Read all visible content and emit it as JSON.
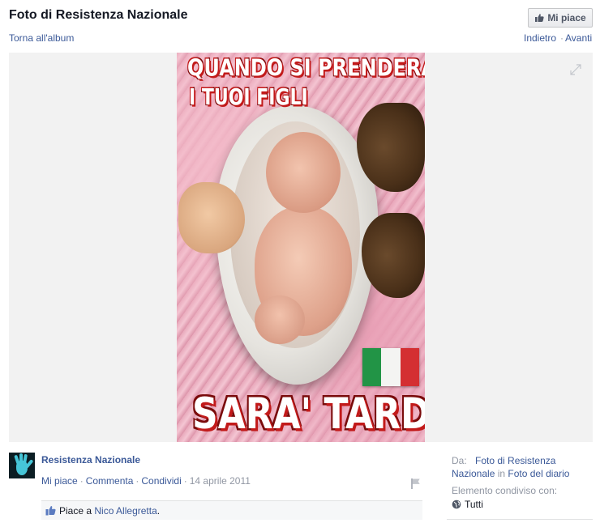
{
  "header": {
    "title": "Foto di Resistenza Nazionale",
    "back_link": "Torna all'album",
    "like_button": "Mi piace",
    "nav_prev": "Indietro",
    "nav_separator": "·",
    "nav_next": "Avanti"
  },
  "photo": {
    "headline_line1": "QUANDO SI PRENDERANNO",
    "headline_line2": "I TUOI FIGLI",
    "headline_bottom": "SARA' TARDI",
    "flag_colors": [
      "#229446",
      "#f4f4f2",
      "#d42f32"
    ]
  },
  "post": {
    "author": "Resistenza Nazionale",
    "actions": [
      "Mi piace",
      "Commenta",
      "Condividi"
    ],
    "date": "14 aprile 2011",
    "likes_prefix": "Piace a",
    "likes_name": "Nico Allegretta",
    "likes_suffix": "."
  },
  "sidebar": {
    "from_label": "Da:",
    "from_link": "Foto di Resistenza Nazionale",
    "from_in": "in",
    "album_link": "Foto del diario",
    "shared_label": "Elemento condiviso con:",
    "audience": "Tutti"
  },
  "colors": {
    "link": "#3b5998",
    "muted": "#9197a3",
    "stage_background": "#f2f2f2"
  }
}
